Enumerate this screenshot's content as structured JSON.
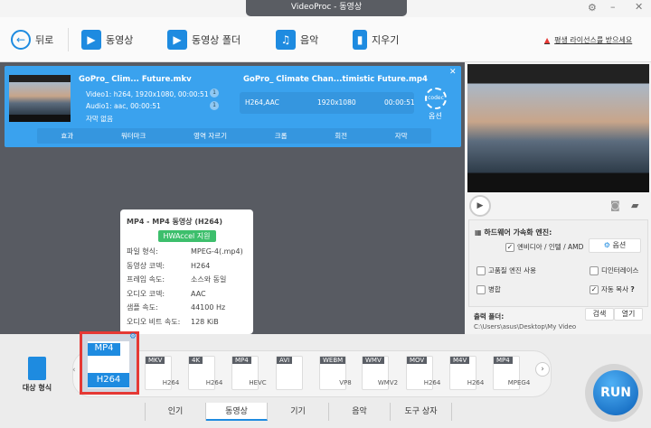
{
  "window": {
    "title": "VideoProc - 동영상"
  },
  "toolbar": {
    "back": "뒤로",
    "video": "동영상",
    "video_folder": "동영상 폴더",
    "music": "음악",
    "clear": "지우기",
    "license": "평생 라이선스를 받으세요"
  },
  "file": {
    "source_name": "GoPro_ Clim... Future.mkv",
    "video_track": "Video1: h264, 1920x1080, 00:00:51",
    "audio_track": "Audio1: aac, 00:00:51",
    "subtitle": "자막 없음",
    "video_badge": "1",
    "audio_badge": "1",
    "output_name": "GoPro_ Climate Chan...timistic Future.mp4",
    "codec": "H264,AAC",
    "resolution": "1920x1080",
    "duration": "00:00:51",
    "option": "옵션",
    "codec_icon_text": "codec"
  },
  "edit_tools": [
    "효과",
    "워터마크",
    "영역 자르기",
    "크롭",
    "회전",
    "자막"
  ],
  "tooltip": {
    "title": "MP4 - MP4 동영상 (H264)",
    "badge": "HWAccel 지원",
    "rows": [
      [
        "파일 형식:",
        "MPEG-4(.mp4)"
      ],
      [
        "동영상 코덱:",
        "H264"
      ],
      [
        "프레임 속도:",
        "소스와 동일"
      ],
      [
        "오디오 코덱:",
        "AAC"
      ],
      [
        "샘플 속도:",
        "44100 Hz"
      ],
      [
        "오디오 비트 속도:",
        "128 KiB"
      ]
    ]
  },
  "settings": {
    "hw_title": "하드웨어 가속화 엔진:",
    "hw_option": "엔비디아 / 인텔 / AMD",
    "option_btn": "옵션",
    "high_quality": "고품질 엔진 사용",
    "deinterlace": "디인터레이스",
    "merge": "병합",
    "auto_copy": "자동 복사",
    "help": "?",
    "output_label": "출력 폴더:",
    "browse": "검색",
    "open": "열기",
    "output_path": "C:\\Users\\asus\\Desktop\\My Video"
  },
  "target": {
    "label": "대상 형식",
    "selected": {
      "top": "MP4",
      "bottom": "H264"
    },
    "formats": [
      [
        "MKV",
        "H264"
      ],
      [
        "4K",
        "H264"
      ],
      [
        "MP4",
        "HEVC"
      ],
      [
        "AVI",
        ""
      ],
      [
        "WEBM",
        "VP8"
      ],
      [
        "WMV",
        "WMV2"
      ],
      [
        "MOV",
        "H264"
      ],
      [
        "M4V",
        "H264"
      ],
      [
        "MP4",
        "MPEG4"
      ]
    ]
  },
  "tabs": [
    "인기",
    "동영상",
    "기기",
    "음악",
    "도구 상자"
  ],
  "run": "RUN",
  "colors": {
    "accent": "#1e8be0",
    "card": "#3aa2ee",
    "highlight": "#e53935"
  }
}
